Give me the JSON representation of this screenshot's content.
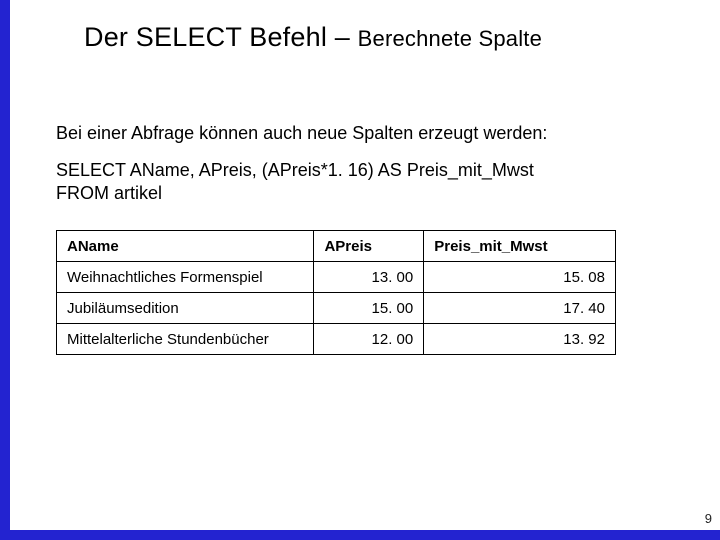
{
  "title": {
    "main": "Der SELECT Befehl – ",
    "sub": "Berechnete Spalte"
  },
  "intro": "Bei einer Abfrage können auch neue Spalten erzeugt werden:",
  "sql": {
    "line1": "SELECT AName, APreis, (APreis*1. 16) AS Preis_mit_Mwst",
    "line2": "FROM artikel"
  },
  "table": {
    "headers": {
      "c1": "AName",
      "c2": "APreis",
      "c3": "Preis_mit_Mwst"
    },
    "rows": [
      {
        "c1": "Weihnachtliches Formenspiel",
        "c2": "13. 00",
        "c3": "15. 08"
      },
      {
        "c1": "Jubiläumsedition",
        "c2": "15. 00",
        "c3": "17. 40"
      },
      {
        "c1": "Mittelalterliche Stundenbücher",
        "c2": "12. 00",
        "c3": "13. 92"
      }
    ]
  },
  "page_number": "9"
}
